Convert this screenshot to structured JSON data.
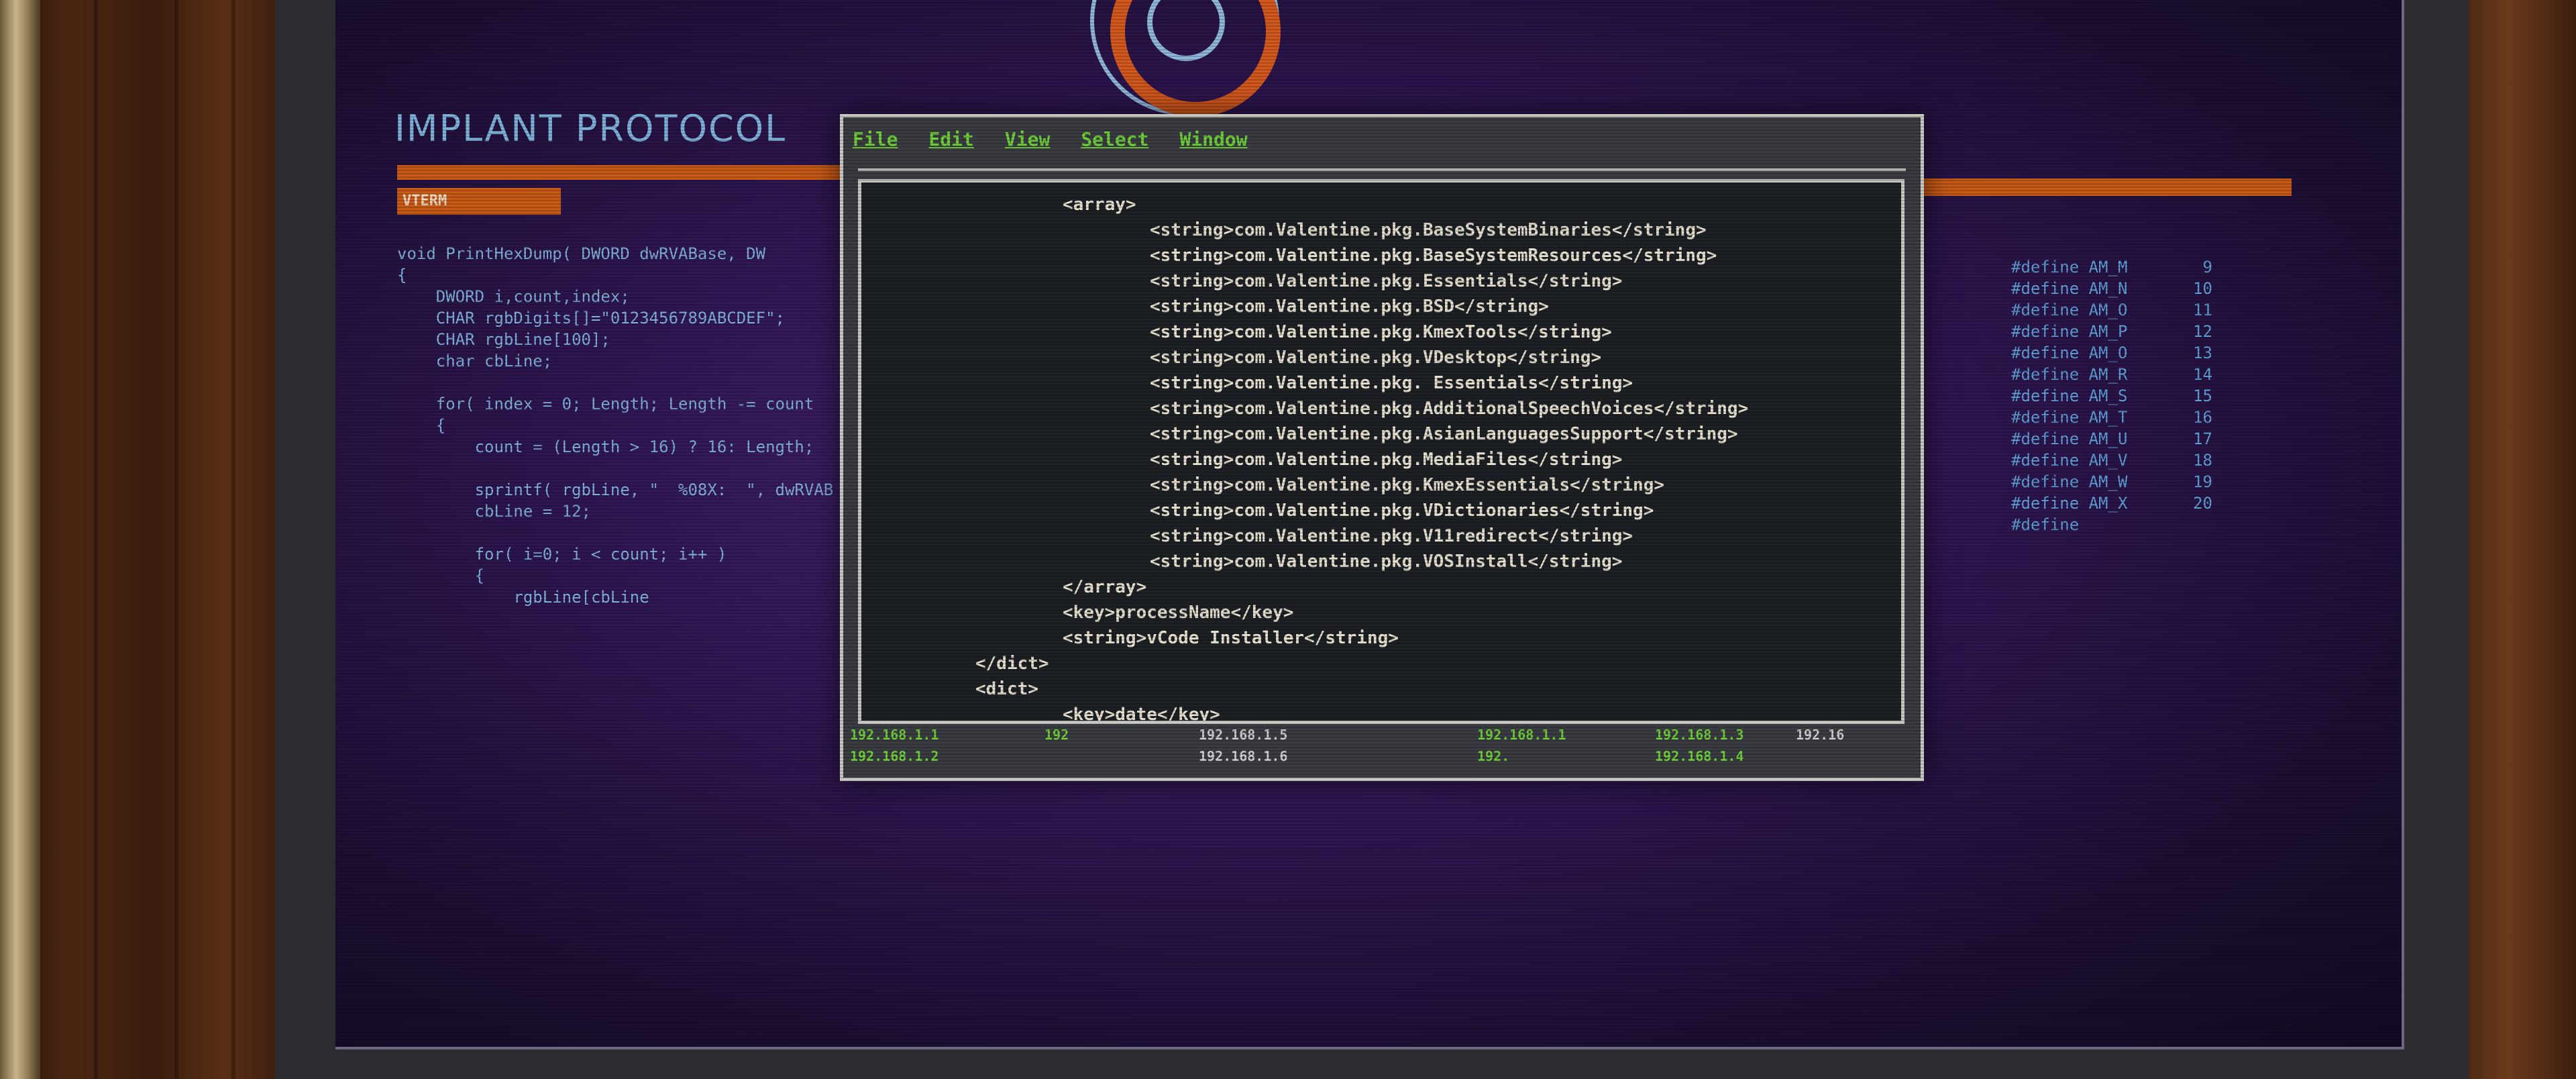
{
  "panel": {
    "title": "IMPLANT PROTOCOL",
    "vterm_label": "VTERM",
    "code_lines": [
      "void PrintHexDump( DWORD dwRVABase, DW",
      "{",
      "    DWORD i,count,index;",
      "    CHAR rgbDigits[]=\"0123456789ABCDEF\";",
      "    CHAR rgbLine[100];",
      "    char cbLine;",
      "",
      "    for( index = 0; Length; Length -= count",
      "    {",
      "        count = (Length > 16) ? 16: Length;",
      "",
      "        sprintf( rgbLine, \"  %08X:  \", dwRVAB",
      "        cbLine = 12;",
      "",
      "        for( i=0; i < count; i++ )",
      "        {",
      "            rgbLine[cbLine"
    ]
  },
  "defines": [
    {
      "name": "#define AM_M",
      "value": "9"
    },
    {
      "name": "#define AM_N",
      "value": "10"
    },
    {
      "name": "#define AM_O",
      "value": "11"
    },
    {
      "name": "#define AM_P",
      "value": "12"
    },
    {
      "name": "#define AM_O",
      "value": "13"
    },
    {
      "name": "#define AM_R",
      "value": "14"
    },
    {
      "name": "#define AM_S",
      "value": "15"
    },
    {
      "name": "#define AM_T",
      "value": "16"
    },
    {
      "name": "#define AM_U",
      "value": "17"
    },
    {
      "name": "#define AM_V",
      "value": "18"
    },
    {
      "name": "#define AM_W",
      "value": "19"
    },
    {
      "name": "#define AM_X",
      "value": "20"
    },
    {
      "name": "#define",
      "value": ""
    }
  ],
  "terminal": {
    "menu": [
      "File",
      "Edit",
      "View",
      "Select",
      "Window"
    ],
    "xml_lines": [
      {
        "indent": 1,
        "text": "<array>"
      },
      {
        "indent": 2,
        "text": "<string>com.Valentine.pkg.BaseSystemBinaries</string>"
      },
      {
        "indent": 2,
        "text": "<string>com.Valentine.pkg.BaseSystemResources</string>"
      },
      {
        "indent": 2,
        "text": "<string>com.Valentine.pkg.Essentials</string>"
      },
      {
        "indent": 2,
        "text": "<string>com.Valentine.pkg.BSD</string>"
      },
      {
        "indent": 2,
        "text": "<string>com.Valentine.pkg.KmexTools</string>"
      },
      {
        "indent": 2,
        "text": "<string>com.Valentine.pkg.VDesktop</string>"
      },
      {
        "indent": 2,
        "text": "<string>com.Valentine.pkg. Essentials</string>"
      },
      {
        "indent": 2,
        "text": "<string>com.Valentine.pkg.AdditionalSpeechVoices</string>"
      },
      {
        "indent": 2,
        "text": "<string>com.Valentine.pkg.AsianLanguagesSupport</string>"
      },
      {
        "indent": 2,
        "text": "<string>com.Valentine.pkg.MediaFiles</string>"
      },
      {
        "indent": 2,
        "text": "<string>com.Valentine.pkg.KmexEssentials</string>"
      },
      {
        "indent": 2,
        "text": "<string>com.Valentine.pkg.VDictionaries</string>"
      },
      {
        "indent": 2,
        "text": "<string>com.Valentine.pkg.V11redirect</string>"
      },
      {
        "indent": 2,
        "text": "<string>com.Valentine.pkg.VOSInstall</string>"
      },
      {
        "indent": 1,
        "text": "</array>"
      },
      {
        "indent": 1,
        "text": "<key>processName</key>"
      },
      {
        "indent": 1,
        "text": "<string>vCode Installer</string>"
      },
      {
        "indent": 0,
        "text": "</dict>"
      },
      {
        "indent": 0,
        "text": "<dict>"
      },
      {
        "indent": 1,
        "text": "<key>date</key>"
      }
    ],
    "ip_row1": [
      "192.168.1.1",
      "192",
      "192.168.1.5",
      "192.168.1.1",
      "192.168.1.3",
      "192.16"
    ],
    "ip_row2": [
      "192.168.1.2",
      "",
      "192.168.1.6",
      "192.",
      "192.168.1.4",
      ""
    ]
  },
  "bottom": {
    "items": [
      "192.168.1.5",
      "19",
      "192.168.1.4"
    ]
  },
  "colors": {
    "accent_orange": "#c75a17",
    "code_blue": "#7fb2d8",
    "menu_green": "#6fd13a",
    "ip_green": "#6fd13a",
    "ip_grey": "#cfcfcf"
  }
}
